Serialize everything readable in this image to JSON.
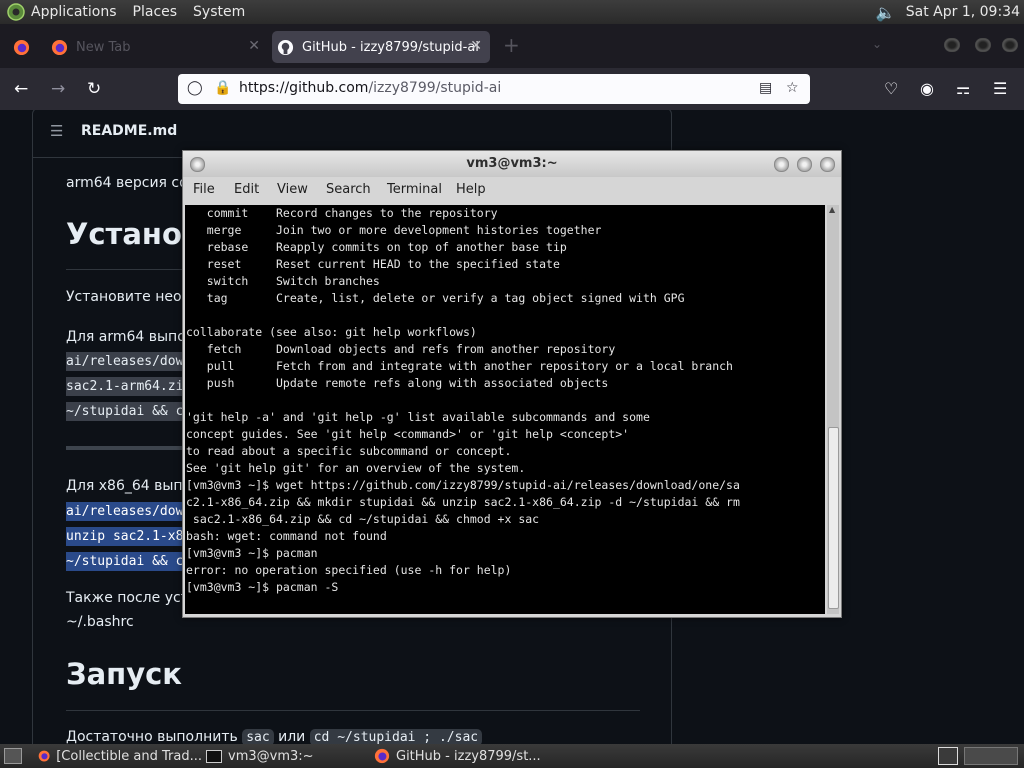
{
  "top_panel": {
    "menus": [
      "Applications",
      "Places",
      "System"
    ],
    "clock": "Sat Apr  1, 09:34"
  },
  "browser": {
    "tabs": [
      {
        "label": ""
      },
      {
        "label": "New Tab"
      },
      {
        "label": "GitHub - izzy8799/stupid-ai"
      }
    ],
    "url": {
      "host": "https://github.com",
      "path": "/izzy8799/stupid-ai"
    }
  },
  "readme": {
    "title": "README.md",
    "lines": {
      "arm64_version": "arm64 версия со",
      "install_heading": "Установ",
      "install_text": "Установите необ",
      "arm64_cmd_intro": "Для arm64 выпо",
      "arm64_code1": "ai/releases/dow",
      "arm64_code2": "sac2.1-arm64.zi",
      "arm64_code3": "~/stupidai && c",
      "x86_cmd_intro": "Для x86_64 вып",
      "x86_code1": "ai/releases/dow",
      "x86_code2": "unzip sac2.1-x8",
      "x86_code3": "~/stupidai && c",
      "also_after": "Также после уст",
      "bashrc": "~/.bashrc",
      "run_heading": "Запуск",
      "run_text_prefix": "Достаточно выполнить",
      "run_code1": "sac",
      "run_or": "или",
      "run_code2": "cd ~/stupidai ; ./sac"
    }
  },
  "terminal": {
    "title": "vm3@vm3:~",
    "menus": [
      "File",
      "Edit",
      "View",
      "Search",
      "Terminal",
      "Help"
    ],
    "lines": [
      "   commit    Record changes to the repository",
      "   merge     Join two or more development histories together",
      "   rebase    Reapply commits on top of another base tip",
      "   reset     Reset current HEAD to the specified state",
      "   switch    Switch branches",
      "   tag       Create, list, delete or verify a tag object signed with GPG",
      "",
      "collaborate (see also: git help workflows)",
      "   fetch     Download objects and refs from another repository",
      "   pull      Fetch from and integrate with another repository or a local branch",
      "   push      Update remote refs along with associated objects",
      "",
      "'git help -a' and 'git help -g' list available subcommands and some",
      "concept guides. See 'git help <command>' or 'git help <concept>'",
      "to read about a specific subcommand or concept.",
      "See 'git help git' for an overview of the system.",
      "[vm3@vm3 ~]$ wget https://github.com/izzy8799/stupid-ai/releases/download/one/sa",
      "c2.1-x86_64.zip && mkdir stupidai && unzip sac2.1-x86_64.zip -d ~/stupidai && rm",
      " sac2.1-x86_64.zip && cd ~/stupidai && chmod +x sac",
      "bash: wget: command not found",
      "[vm3@vm3 ~]$ pacman",
      "error: no operation specified (use -h for help)",
      "[vm3@vm3 ~]$ pacman -S "
    ]
  },
  "taskbar": {
    "tasks": [
      {
        "label": "[Collectible and Trad..."
      },
      {
        "label": "vm3@vm3:~"
      },
      {
        "label": "GitHub - izzy8799/st..."
      }
    ]
  },
  "colors": {
    "github_bg": "#0d1117",
    "terminal_bg": "#000000",
    "firefox_toolbar": "#2b2a33",
    "selection": "#2a4a8a"
  }
}
